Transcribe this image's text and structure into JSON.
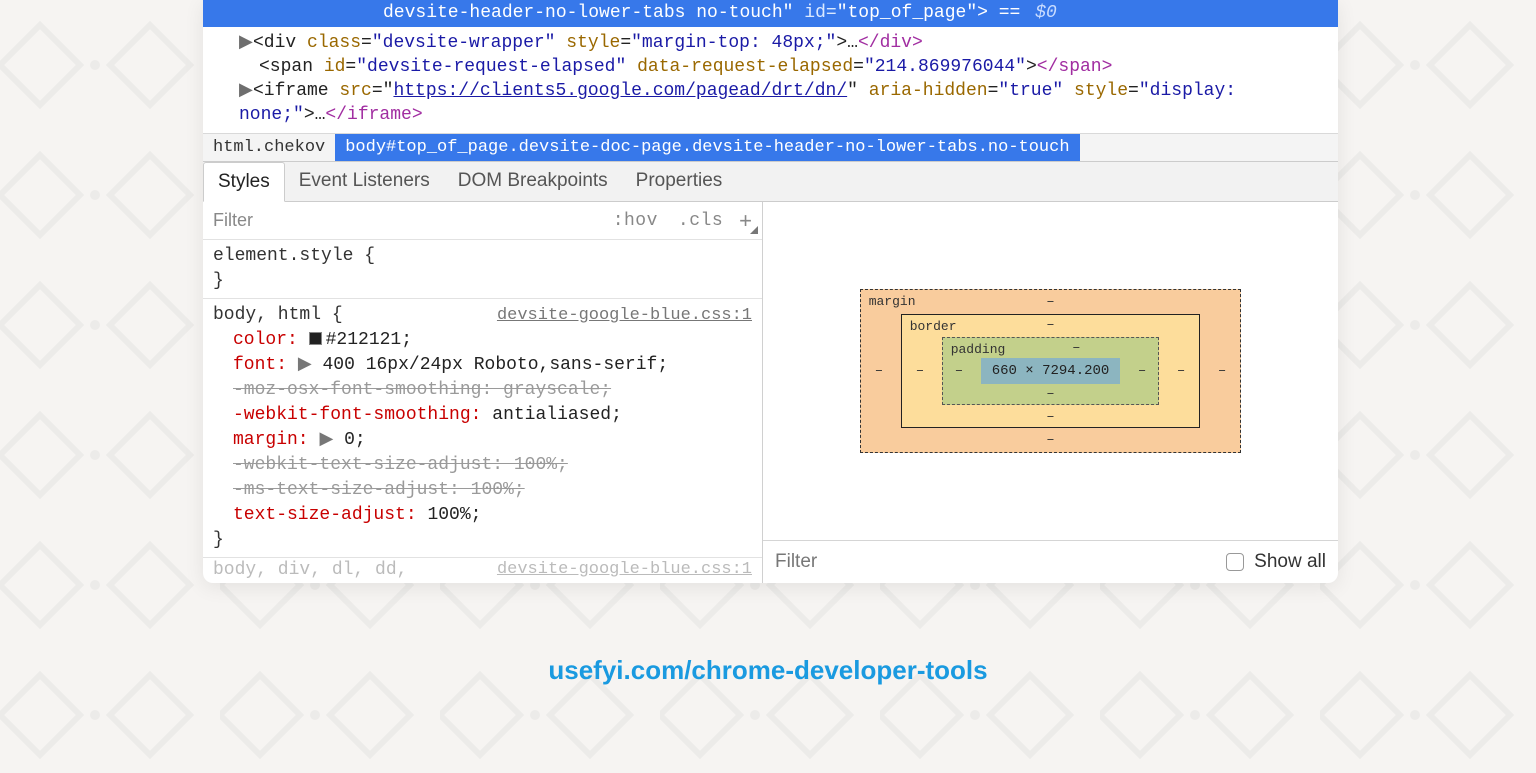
{
  "selected_line": {
    "classes_part": "devsite-header-no-lower-tabs no-touch\"",
    "id_attr": "id",
    "id_val": "\"top_of_page\"",
    "tail": "> == ",
    "dollar": "$0"
  },
  "dom": {
    "l1": {
      "open": "<div ",
      "a1n": "class",
      "a1v": "\"devsite-wrapper\"",
      "a2n": "style",
      "a2v": "\"margin-top: 48px;\"",
      "ell": ">…",
      "close": "</div>"
    },
    "l2": {
      "open": "<span ",
      "a1n": "id",
      "a1v": "\"devsite-request-elapsed\"",
      "a2n": "data-request-elapsed",
      "a2v": "\"214.869976044\"",
      "mid": ">",
      "close": "</span>"
    },
    "l3": {
      "open": "<iframe ",
      "a1n": "src",
      "a1v": "https://clients5.google.com/pagead/drt/dn/",
      "q": "\"",
      "a2n": "aria-hidden",
      "a2v": "\"true\"",
      "a3n": "style",
      "a3v": "\"display:",
      "cont": "none;\"",
      "ell": ">…",
      "close": "</iframe>"
    }
  },
  "breadcrumb": {
    "a": "html.chekov",
    "b": "body#top_of_page.devsite-doc-page.devsite-header-no-lower-tabs.no-touch"
  },
  "subtabs": [
    "Styles",
    "Event Listeners",
    "DOM Breakpoints",
    "Properties"
  ],
  "styles_filter": {
    "placeholder": "Filter",
    "hov": ":hov",
    "cls": ".cls"
  },
  "rules": {
    "r0": {
      "sel": "element.style {",
      "close": "}"
    },
    "r1": {
      "sel": "body, html {",
      "src": "devsite-google-blue.css:1",
      "p_color_n": "color:",
      "p_color_v": "#212121;",
      "p_font_n": "font:",
      "p_font_v": "400 16px/24px Roboto,sans-serif;",
      "p_mozsmooth": "-moz-osx-font-smoothing: grayscale;",
      "p_wksmooth_n": "-webkit-font-smoothing:",
      "p_wksmooth_v": "antialiased;",
      "p_margin_n": "margin:",
      "p_margin_v": "0;",
      "p_wktsa": "-webkit-text-size-adjust: 100%;",
      "p_mstsa": "-ms-text-size-adjust: 100%;",
      "p_tsa_n": "text-size-adjust:",
      "p_tsa_v": "100%;",
      "close": "}"
    },
    "r_fade": {
      "sel": "body, div, dl, dd,",
      "src": "devsite-google-blue.css:1"
    }
  },
  "box_model": {
    "margin": "margin",
    "border": "border",
    "padding": "padding",
    "content": "660 × 7294.200",
    "dash": "–"
  },
  "computed_filter": {
    "placeholder": "Filter",
    "showall": "Show all"
  },
  "footer": "usefyi.com/chrome-developer-tools"
}
